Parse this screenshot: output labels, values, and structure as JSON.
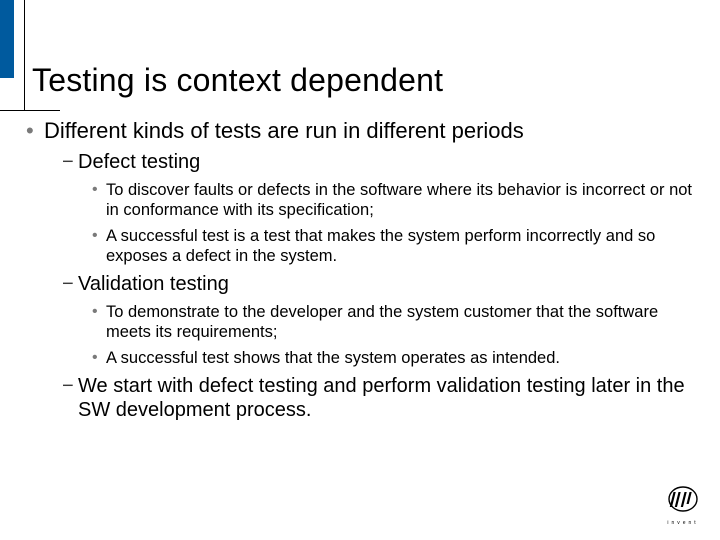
{
  "title": "Testing is context dependent",
  "lvl1": "Different kinds of tests are run in different periods",
  "sec1": {
    "heading": "Defect testing",
    "p1": "To discover faults or defects in the software where its behavior is incorrect or not in conformance with its specification;",
    "p2": "A successful test is a test that makes the system perform incorrectly and so exposes a defect in the system."
  },
  "sec2": {
    "heading": "Validation testing",
    "p1": "To demonstrate to the developer and the system customer that the software meets its requirements;",
    "p2": "A successful test shows that the system operates as intended."
  },
  "closing": "We start with defect testing and perform validation testing later in the SW development process.",
  "logo": {
    "brand": "hp",
    "tag": "invent"
  }
}
